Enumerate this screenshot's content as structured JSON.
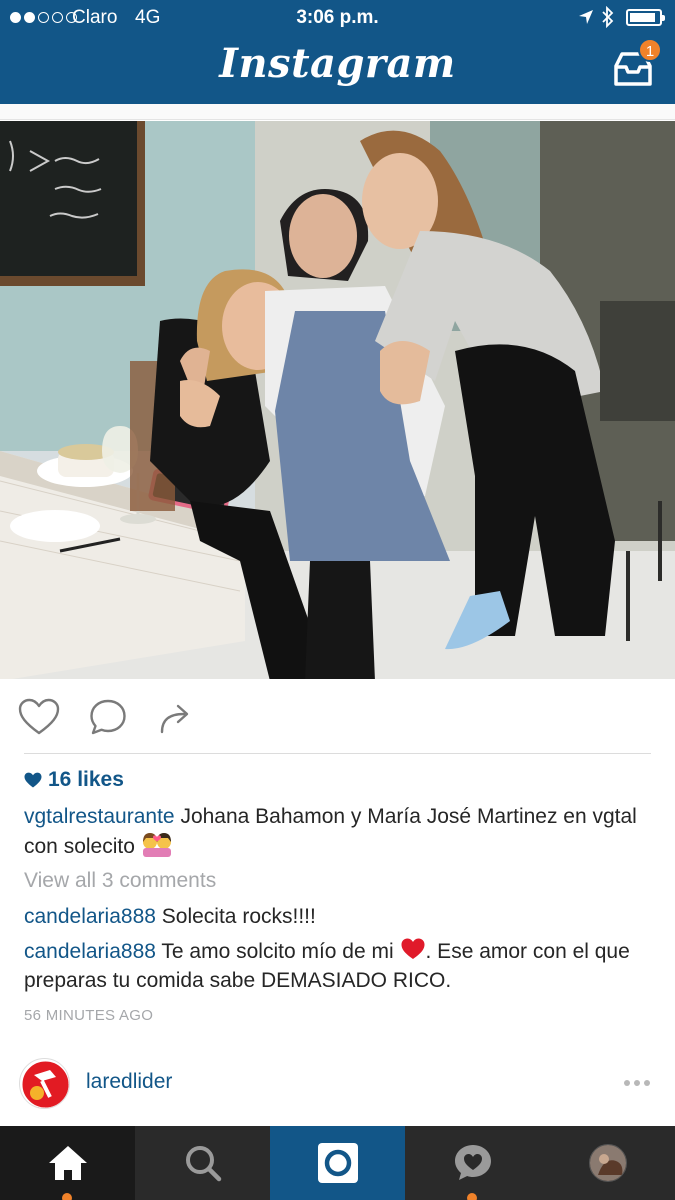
{
  "status_bar": {
    "carrier": "Claro",
    "network": "4G",
    "time": "3:06 p.m.",
    "signal_strength": 2,
    "signal_max": 5,
    "battery_level": 0.9
  },
  "header": {
    "title": "Instagram",
    "inbox_badge": "1"
  },
  "post": {
    "likes": "16 likes",
    "caption_user": "vgtalrestaurante",
    "caption_text": "Johana Bahamon y María José Martinez en vgtal con solecito",
    "view_comments": "View all 3 comments",
    "comments": [
      {
        "user": "candelaria888",
        "text": "Solecita rocks!!!!"
      },
      {
        "user": "candelaria888",
        "text_before": "Te amo solcito mío de mi",
        "text_after": ". Ese amor con el que preparas tu comida sabe DEMASIADO RICO."
      }
    ],
    "time_ago": "56 MINUTES AGO"
  },
  "next_post": {
    "user": "laredlider"
  },
  "icons": {
    "like": "heart-outline-icon",
    "comment": "speech-bubble-icon",
    "share": "share-arrow-icon"
  },
  "colors": {
    "brand": "#125688",
    "accent": "#f0822a",
    "muted": "#a5a7aa",
    "tabbar": "#2a2a2a"
  }
}
